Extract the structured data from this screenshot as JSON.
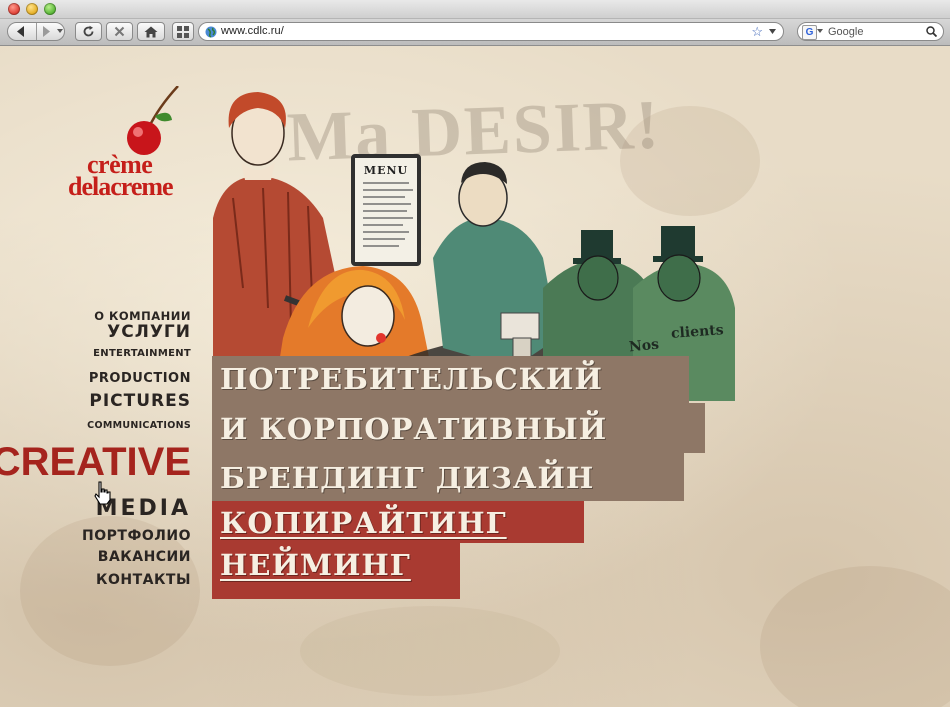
{
  "browser": {
    "url": "www.cdlc.ru/",
    "search_placeholder": "Google",
    "search_engine_icon": "G"
  },
  "logo": {
    "line1": "crème",
    "line2": "delacreme",
    "color": "#c51f1a"
  },
  "nav": {
    "items": [
      "О КОМПАНИИ",
      "УСЛУГИ",
      "ENTERTAINMENT",
      "PRODUCTION",
      "PICTURES",
      "COMMUNICATIONS",
      "CREATIVE",
      "MEDIA",
      "ПОРТФОЛИО",
      "ВАКАНСИИ",
      "КОНТАКТЫ"
    ],
    "active": "CREATIVE",
    "active_color": "#a5241d"
  },
  "illustration": {
    "motto": "Ma DESIR!",
    "menu_title": "MENU",
    "nos": "Nos",
    "clients": "clients"
  },
  "headline": {
    "lines": [
      "ПОТРЕБИТЕЛЬСКИЙ",
      "И КОРПОРАТИВНЫЙ",
      "БРЕНДИНГ ДИЗАЙН",
      "КОПИРАЙТИНГ",
      "НЕЙМИНГ"
    ],
    "brown": "#8e7766",
    "red": "#a93a31"
  }
}
